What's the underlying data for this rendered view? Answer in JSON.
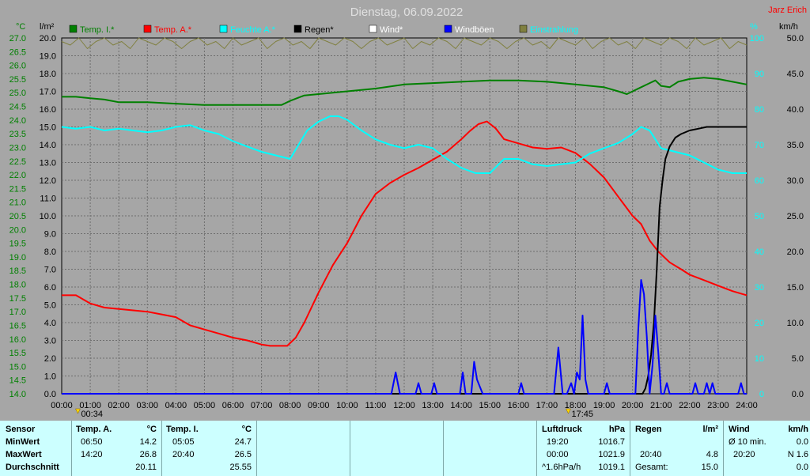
{
  "chart_data": {
    "type": "line",
    "title": "Dienstag, 06.09.2022",
    "author": "Jarz Erich",
    "axes": {
      "temp_unit": "°C",
      "rain_unit": "l/m²",
      "hum_unit": "%",
      "wind_unit": "km/h",
      "temp_ticks": [
        "27.0",
        "26.5",
        "26.0",
        "25.5",
        "25.0",
        "24.5",
        "24.0",
        "23.5",
        "23.0",
        "22.5",
        "22.0",
        "21.5",
        "21.0",
        "20.5",
        "20.0",
        "19.5",
        "19.0",
        "18.5",
        "18.0",
        "17.5",
        "17.0",
        "16.5",
        "16.0",
        "15.5",
        "15.0",
        "14.5",
        "14.0"
      ],
      "rain_ticks": [
        "20.0",
        "19.0",
        "18.0",
        "17.0",
        "16.0",
        "15.0",
        "14.0",
        "13.0",
        "12.0",
        "11.0",
        "10.0",
        "9.0",
        "8.0",
        "7.0",
        "6.0",
        "5.0",
        "4.0",
        "3.0",
        "2.0",
        "1.0",
        "0.0"
      ],
      "hum_ticks": [
        "100",
        "90",
        "80",
        "70",
        "60",
        "50",
        "40",
        "30",
        "20",
        "10",
        "0"
      ],
      "wind_ticks": [
        "50.0",
        "45.0",
        "40.0",
        "35.0",
        "30.0",
        "25.0",
        "20.0",
        "15.0",
        "10.0",
        "5.0",
        "0.0"
      ],
      "x_ticks": [
        "00:00",
        "01:00",
        "02:00",
        "03:00",
        "04:00",
        "05:00",
        "06:00",
        "07:00",
        "08:00",
        "09:00",
        "10:00",
        "11:00",
        "12:00",
        "13:00",
        "14:00",
        "15:00",
        "16:00",
        "17:00",
        "18:00",
        "19:00",
        "20:00",
        "21:00",
        "22:00",
        "23:00",
        "24:00"
      ],
      "temp_range": [
        14.0,
        27.0
      ],
      "rain_range": [
        0,
        20
      ],
      "hum_range": [
        0,
        100
      ],
      "wind_range": [
        0,
        50
      ],
      "x_range_h": [
        0,
        24
      ],
      "grid": true
    },
    "legend": [
      {
        "name": "Temp. I.*",
        "color": "#008000"
      },
      {
        "name": "Temp. A.*",
        "color": "#ff0000"
      },
      {
        "name": "Feuchte A.*",
        "color": "#00ffff"
      },
      {
        "name": "Regen*",
        "color": "#000000"
      },
      {
        "name": "Wind*",
        "color": "#ffffff"
      },
      {
        "name": "Windböen",
        "color": "#0000ff"
      },
      {
        "name": "Einstrahlung",
        "color": "#808040"
      }
    ],
    "sun_markers": [
      {
        "label": "00:34"
      },
      {
        "label": "17:45"
      }
    ],
    "series": [
      {
        "name": "Temp. I.*",
        "axis": "temp",
        "color": "#008000",
        "x": [
          0,
          0.5,
          1,
          1.5,
          2,
          3,
          4,
          5,
          6,
          7,
          7.7,
          8,
          8.5,
          9,
          10,
          11,
          12,
          13,
          14,
          15,
          16,
          17,
          18,
          19,
          19.5,
          19.8,
          20,
          20.3,
          20.6,
          20.8,
          21,
          21.3,
          21.6,
          22,
          22.5,
          23,
          23.5,
          24
        ],
        "y": [
          24.85,
          24.85,
          24.8,
          24.75,
          24.65,
          24.65,
          24.6,
          24.55,
          24.55,
          24.55,
          24.55,
          24.7,
          24.9,
          24.95,
          25.05,
          25.15,
          25.3,
          25.35,
          25.4,
          25.45,
          25.45,
          25.4,
          25.3,
          25.2,
          25.05,
          24.95,
          25.05,
          25.2,
          25.35,
          25.45,
          25.25,
          25.2,
          25.4,
          25.5,
          25.55,
          25.5,
          25.4,
          25.3
        ]
      },
      {
        "name": "Temp. A.*",
        "axis": "temp",
        "color": "#ff0000",
        "x": [
          0,
          0.5,
          1,
          1.5,
          2,
          3,
          3.5,
          4,
          4.5,
          5,
          5.5,
          6,
          6.5,
          7,
          7.3,
          7.6,
          7.9,
          8.2,
          8.5,
          9,
          9.5,
          10,
          10.5,
          11,
          11.5,
          12,
          12.5,
          13,
          13.5,
          14,
          14.3,
          14.6,
          14.9,
          15.2,
          15.5,
          16,
          16.5,
          17,
          17.5,
          18,
          18.5,
          19,
          19.5,
          20,
          20.3,
          20.6,
          20.9,
          21.3,
          21.7,
          22,
          22.5,
          23,
          23.5,
          24
        ],
        "y": [
          17.6,
          17.6,
          17.3,
          17.15,
          17.1,
          17.0,
          16.9,
          16.8,
          16.5,
          16.35,
          16.2,
          16.05,
          15.95,
          15.8,
          15.75,
          15.75,
          15.75,
          16.05,
          16.6,
          17.7,
          18.7,
          19.5,
          20.5,
          21.3,
          21.7,
          22.0,
          22.25,
          22.55,
          22.85,
          23.3,
          23.6,
          23.85,
          23.95,
          23.7,
          23.3,
          23.15,
          23.0,
          22.95,
          23.0,
          22.8,
          22.4,
          21.9,
          21.2,
          20.5,
          20.2,
          19.6,
          19.2,
          18.8,
          18.55,
          18.35,
          18.15,
          17.95,
          17.75,
          17.6
        ]
      },
      {
        "name": "Feuchte A.*",
        "axis": "hum",
        "color": "#00ffff",
        "x": [
          0,
          0.5,
          1,
          1.5,
          2,
          2.5,
          3,
          3.5,
          4,
          4.5,
          5,
          5.5,
          6,
          6.5,
          7,
          7.5,
          8,
          8.3,
          8.6,
          9,
          9.4,
          9.7,
          10,
          10.5,
          11,
          11.5,
          12,
          12.5,
          13,
          13.5,
          14,
          14.5,
          15,
          15.5,
          16,
          16.5,
          17,
          17.5,
          18,
          18.5,
          19,
          19.5,
          20,
          20.3,
          20.6,
          21,
          21.5,
          22,
          22.5,
          23,
          23.5,
          24
        ],
        "y": [
          75,
          74.5,
          75,
          74,
          74.5,
          74,
          73.5,
          74,
          75,
          75.5,
          74,
          73,
          71,
          69.5,
          68,
          67,
          66,
          70,
          74,
          76.5,
          78,
          78,
          77,
          74,
          71.5,
          70,
          69,
          70,
          69,
          66,
          63.5,
          62,
          62,
          66,
          66,
          64.5,
          64,
          64.5,
          65,
          67.5,
          69,
          70.5,
          73,
          75,
          74,
          69,
          68,
          67,
          65,
          63,
          62,
          62
        ]
      },
      {
        "name": "Regen*",
        "axis": "rain",
        "color": "#000000",
        "x": [
          0,
          20.35,
          20.45,
          20.55,
          20.65,
          20.75,
          20.85,
          20.95,
          21.05,
          21.15,
          21.3,
          21.5,
          21.7,
          22,
          22.3,
          22.6,
          23,
          23.5,
          24
        ],
        "y": [
          0,
          0,
          0.3,
          1.0,
          2.2,
          4.0,
          7.0,
          10.5,
          12.0,
          13.2,
          13.9,
          14.4,
          14.6,
          14.8,
          14.9,
          15.0,
          15.0,
          15.0,
          15.0
        ]
      },
      {
        "name": "Windböen",
        "axis": "wind",
        "color": "#0000ff",
        "x": [
          0,
          11.55,
          11.7,
          11.85,
          12.0,
          12.4,
          12.5,
          12.6,
          12.95,
          13.05,
          13.15,
          13.95,
          14.05,
          14.15,
          14.35,
          14.45,
          14.55,
          14.65,
          14.75,
          16.0,
          16.1,
          16.2,
          17.25,
          17.4,
          17.55,
          17.7,
          17.85,
          17.95,
          18.05,
          18.15,
          18.25,
          18.35,
          18.45,
          18.55,
          19.0,
          19.1,
          19.2,
          20.1,
          20.2,
          20.3,
          20.4,
          20.5,
          20.6,
          20.7,
          20.8,
          20.9,
          21.0,
          21.1,
          21.2,
          21.3,
          21.4,
          21.5,
          21.6,
          21.7,
          22.1,
          22.2,
          22.3,
          22.5,
          22.6,
          22.7,
          22.8,
          22.9,
          23.0,
          23.7,
          23.8,
          23.9,
          24
        ],
        "y": [
          0,
          0,
          3,
          0,
          0,
          0,
          1.5,
          0,
          0,
          1.5,
          0,
          0,
          3,
          0,
          0,
          4.5,
          2,
          1,
          0,
          0,
          1.5,
          0,
          0,
          6.5,
          0,
          0,
          1.5,
          0,
          3,
          2,
          11,
          2,
          0,
          0,
          0,
          1.5,
          0,
          0,
          9,
          16,
          14,
          8,
          0,
          4,
          11,
          6,
          0,
          0,
          1.5,
          0,
          0,
          0,
          0,
          0,
          0,
          1.5,
          0,
          0,
          1.5,
          0,
          1.5,
          0,
          0,
          0,
          1.5,
          0,
          0
        ]
      },
      {
        "name": "Einstrahlung",
        "axis": "hum",
        "color": "#808040",
        "x": [
          0,
          0.3,
          0.6,
          0.9,
          1.2,
          1.5,
          1.8,
          2.1,
          2.4,
          2.7,
          3.0,
          3.3,
          3.6,
          3.9,
          4.2,
          4.5,
          4.8,
          5.1,
          5.4,
          5.7,
          6.0,
          6.3,
          6.6,
          6.9,
          7.2,
          7.5,
          7.8,
          8.1,
          8.4,
          8.7,
          9.0,
          9.3,
          9.6,
          9.9,
          10.2,
          10.5,
          10.8,
          11.1,
          11.4,
          11.7,
          12.0,
          12.3,
          12.6,
          12.9,
          13.2,
          13.5,
          13.8,
          14.1,
          14.4,
          14.7,
          15.0,
          15.3,
          15.6,
          15.9,
          16.2,
          16.5,
          16.8,
          17.1,
          17.4,
          17.7,
          18.0,
          18.3,
          18.6,
          18.9,
          19.2,
          19.5,
          19.8,
          20.1,
          20.4,
          20.7,
          21.0,
          21.3,
          21.6,
          21.9,
          22.2,
          22.5,
          22.8,
          23.1,
          23.4,
          23.7,
          24.0
        ],
        "y": [
          99,
          98,
          100,
          97,
          99,
          100,
          98,
          99,
          97,
          100,
          99,
          98,
          100,
          99,
          97,
          99,
          100,
          98,
          99,
          97,
          100,
          98,
          99,
          100,
          97,
          99,
          100,
          98,
          99,
          97,
          100,
          99,
          98,
          100,
          99,
          97,
          99,
          100,
          98,
          99,
          100,
          97,
          99,
          98,
          100,
          99,
          97,
          100,
          99,
          98,
          100,
          99,
          97,
          99,
          100,
          98,
          99,
          97,
          100,
          99,
          98,
          100,
          97,
          99,
          100,
          98,
          99,
          97,
          100,
          99,
          98,
          100,
          99,
          97,
          100,
          98,
          99,
          100,
          97,
          99,
          98
        ]
      }
    ]
  },
  "stats": {
    "sensor": {
      "label": "Sensor",
      "min": "MinWert",
      "max": "MaxWert",
      "avg": "Durchschnitt"
    },
    "temp_a": {
      "title": "Temp. A.",
      "unit": "°C",
      "min_time": "06:50",
      "min_val": "14.2",
      "max_time": "14:20",
      "max_val": "26.8",
      "avg": "20.11"
    },
    "temp_i": {
      "title": "Temp. I.",
      "unit": "°C",
      "min_time": "05:05",
      "min_val": "24.7",
      "max_time": "20:40",
      "max_val": "26.5",
      "avg": "25.55"
    },
    "pressure": {
      "title": "Luftdruck",
      "unit": "hPa",
      "r1_time": "19:20",
      "r1_val": "1016.7",
      "r2_time": "00:00",
      "r2_val": "1021.9",
      "r3_time": "^1.6hPa/h",
      "r3_val": "1019.1"
    },
    "rain": {
      "title": "Regen",
      "unit": "l/m²",
      "r2_time": "20:40",
      "r2_val": "4.8",
      "r3_time": "Gesamt:",
      "r3_val": "15.0"
    },
    "wind": {
      "title": "Wind",
      "unit": "km/h",
      "r1_time": "Ø 10 min.",
      "r1_val": "0.0",
      "r2_time": "20:20",
      "r2_val": "N 1.6",
      "r3_val": "0.0"
    }
  }
}
